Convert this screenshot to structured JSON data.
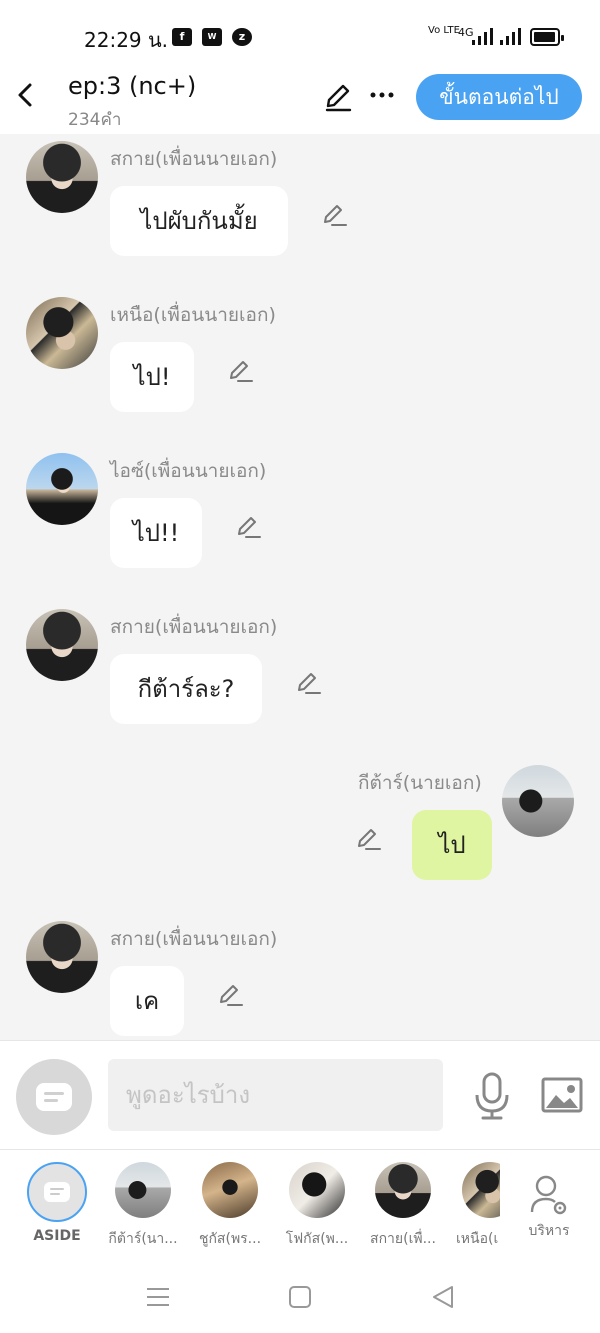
{
  "status_bar": {
    "time": "22:29 น.",
    "app_icons": [
      "facebook-icon",
      "webtoon-icon",
      "zalo-icon"
    ],
    "volte": "Vo LTE",
    "network": "4G"
  },
  "header": {
    "title": "ep:3 (nc+)",
    "word_count": "234คำ",
    "next_button": "ขั้นตอนต่อไป"
  },
  "messages": [
    {
      "sender": "สกาย(เพื่อนนายเอก)",
      "text": "ไปผับกันมั้ย",
      "side": "left",
      "avatar": "avatar-sky"
    },
    {
      "sender": "เหนือ(เพื่อนนายเอก)",
      "text": "ไป!",
      "side": "left",
      "avatar": "avatar-nuea"
    },
    {
      "sender": "ไอซ์(เพื่อนนายเอก)",
      "text": "ไป!!",
      "side": "left",
      "avatar": "avatar-ice"
    },
    {
      "sender": "สกาย(เพื่อนนายเอก)",
      "text": "กีต้าร์ละ?",
      "side": "left",
      "avatar": "avatar-sky"
    },
    {
      "sender": "กีต้าร์(นายเอก)",
      "text": "ไป",
      "side": "right",
      "avatar": "avatar-guitar"
    },
    {
      "sender": "สกาย(เพื่อนนายเอก)",
      "text": "เค",
      "side": "left",
      "avatar": "avatar-sky"
    }
  ],
  "composer": {
    "placeholder": "พูดอะไรบ้าง"
  },
  "characters": [
    {
      "label": "ASIDE"
    },
    {
      "label": "กีต้าร์(นา..."
    },
    {
      "label": "ชูกัส(พร..."
    },
    {
      "label": "โฟกัส(พ..."
    },
    {
      "label": "สกาย(เพื่..."
    },
    {
      "label": "เหนือ(เ"
    },
    {
      "label": "บริหาร"
    }
  ],
  "colors": {
    "accent": "#4aa3f2",
    "chat_bg": "#f4f4f4",
    "my_bubble": "#dff5a1"
  }
}
